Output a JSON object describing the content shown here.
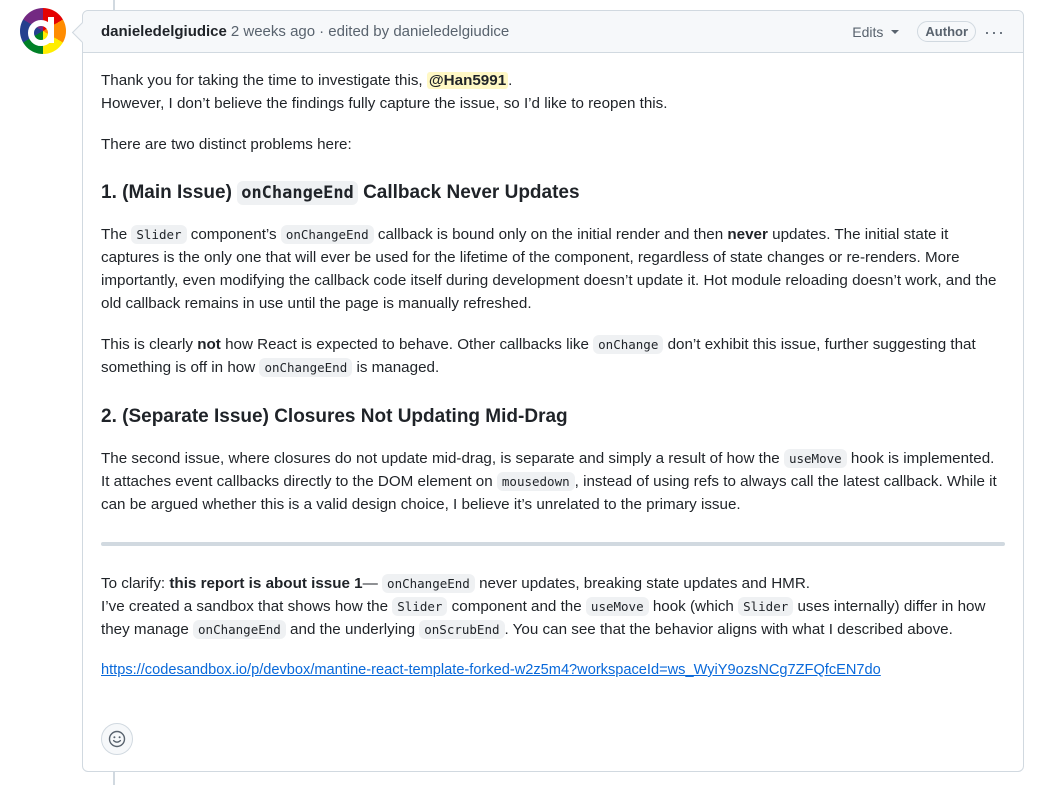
{
  "comment": {
    "author": "danieledelgiudice",
    "timestamp": "2 weeks ago",
    "edited_text": "· edited by danieledelgiudice",
    "edits_label": "Edits",
    "author_badge": "Author",
    "more_icon": "···"
  },
  "avatar_letter": "d",
  "body": {
    "p1_before": "Thank you for taking the time to investigate this, ",
    "mention": "@Han5991",
    "p1_after": ".",
    "p1_line2": "However, I don’t believe the findings fully capture the issue, so I’d like to reopen this.",
    "p2": "There are two distinct problems here:",
    "h1_before": "1. (Main Issue) ",
    "h1_code": "onChangeEnd",
    "h1_after": " Callback Never Updates",
    "p3_a": "The ",
    "p3_code1": "Slider",
    "p3_b": " component’s ",
    "p3_code2": "onChangeEnd",
    "p3_c": " callback is bound only on the initial render and then ",
    "p3_strong": "never",
    "p3_d": " updates. The initial state it captures is the only one that will ever be used for the lifetime of the component, regardless of state changes or re-renders. More importantly, even modifying the callback code itself during development doesn’t update it. Hot module reloading doesn’t work, and the old callback remains in use until the page is manually refreshed.",
    "p4_a": "This is clearly ",
    "p4_strong": "not",
    "p4_b": " how React is expected to behave. Other callbacks like ",
    "p4_code1": "onChange",
    "p4_c": " don’t exhibit this issue, further suggesting that something is off in how ",
    "p4_code2": "onChangeEnd",
    "p4_d": " is managed.",
    "h2": "2. (Separate Issue) Closures Not Updating Mid-Drag",
    "p5_a": "The second issue, where closures do not update mid-drag, is separate and simply a result of how the ",
    "p5_code1": "useMove",
    "p5_b": " hook is implemented. It attaches event callbacks directly to the DOM element on ",
    "p5_code2": "mousedown",
    "p5_c": ", instead of using refs to always call the latest callback. While it can be argued whether this is a valid design choice, I believe it’s unrelated to the primary issue.",
    "p6_a": "To clarify: ",
    "p6_strong": "this report is about issue 1",
    "p6_b": "— ",
    "p6_code1": "onChangeEnd",
    "p6_c": " never updates, breaking state updates and HMR.",
    "p7_a": "I’ve created a sandbox that shows how the ",
    "p7_code1": "Slider",
    "p7_b": " component and the ",
    "p7_code2": "useMove",
    "p7_c": " hook (which ",
    "p7_code3": "Slider",
    "p7_d": " uses internally) differ in how they manage ",
    "p7_code4": "onChangeEnd",
    "p7_e": " and the underlying ",
    "p7_code5": "onScrubEnd",
    "p7_f": ". You can see that the behavior aligns with what I described above.",
    "link": "https://codesandbox.io/p/devbox/mantine-react-template-forked-w2z5m4?workspaceId=ws_WyiY9ozsNCg7ZFQfcEN7do"
  },
  "colors": {
    "link": "#0969da",
    "mention_bg": "#fff8c5",
    "border": "#d1d9e0"
  },
  "icons": {
    "reaction": "smiley-icon",
    "more": "kebab-icon",
    "dropdown": "caret-down-icon"
  }
}
